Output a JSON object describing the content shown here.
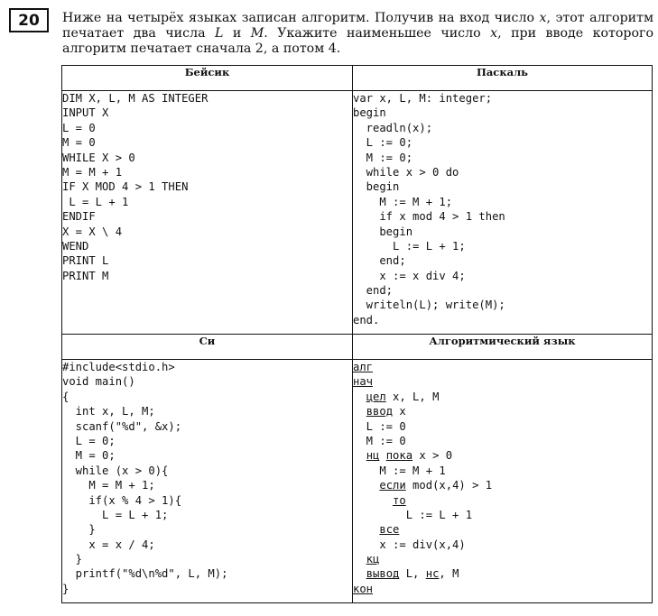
{
  "task": {
    "number": "20",
    "statement_parts": [
      "Ниже на четырёх языках записан алгоритм. Получив на вход число ",
      "x",
      ", этот алгоритм печатает два числа ",
      "L",
      " и ",
      "M",
      ". Укажите наименьшее число ",
      "x",
      ", при вводе которого алгоритм печатает сначала 2, а потом 4."
    ]
  },
  "headers": {
    "basic": "Бейсик",
    "pascal": "Паскаль",
    "c": "Си",
    "algo": "Алгоритмический язык"
  },
  "basic_code": [
    "DIM X, L, M AS INTEGER",
    "INPUT X",
    "L = 0",
    "M = 0",
    "WHILE X > 0",
    "M = M + 1",
    "IF X MOD 4 > 1 THEN",
    " L = L + 1",
    "ENDIF",
    "X = X \\ 4",
    "WEND",
    "PRINT L",
    "PRINT M"
  ],
  "pascal_code": [
    "var x, L, M: integer;",
    "begin",
    "  readln(x);",
    "  L := 0;",
    "  M := 0;",
    "  while x > 0 do",
    "  begin",
    "    M := M + 1;",
    "    if x mod 4 > 1 then",
    "    begin",
    "      L := L + 1;",
    "    end;",
    "    x := x div 4;",
    "  end;",
    "  writeln(L); write(M);",
    "end."
  ],
  "c_code": [
    "#include<stdio.h>",
    "void main()",
    "{",
    "  int x, L, M;",
    "  scanf(\"%d\", &x);",
    "  L = 0;",
    "  M = 0;",
    "  while (x > 0){",
    "    M = M + 1;",
    "    if(x % 4 > 1){",
    "      L = L + 1;",
    "    }",
    "    x = x / 4;",
    "  }",
    "  printf(\"%d\\n%d\", L, M);",
    "}"
  ],
  "algo_code": [
    [
      {
        "t": "алг",
        "u": true
      }
    ],
    [
      {
        "t": "нач",
        "u": true
      }
    ],
    [
      {
        "t": "  "
      },
      {
        "t": "цел",
        "u": true
      },
      {
        "t": " x, L, M"
      }
    ],
    [
      {
        "t": "  "
      },
      {
        "t": "ввод",
        "u": true
      },
      {
        "t": " x"
      }
    ],
    [
      {
        "t": "  L := 0"
      }
    ],
    [
      {
        "t": "  M := 0"
      }
    ],
    [
      {
        "t": "  "
      },
      {
        "t": "нц",
        "u": true
      },
      {
        "t": " "
      },
      {
        "t": "пока",
        "u": true
      },
      {
        "t": " x > 0"
      }
    ],
    [
      {
        "t": "    M := M + 1"
      }
    ],
    [
      {
        "t": "    "
      },
      {
        "t": "если",
        "u": true
      },
      {
        "t": " mod(x,4) > 1"
      }
    ],
    [
      {
        "t": "      "
      },
      {
        "t": "то",
        "u": true
      }
    ],
    [
      {
        "t": "        L := L + 1"
      }
    ],
    [
      {
        "t": "    "
      },
      {
        "t": "все",
        "u": true
      }
    ],
    [
      {
        "t": "    x := div(x,4)"
      }
    ],
    [
      {
        "t": "  "
      },
      {
        "t": "кц",
        "u": true
      }
    ],
    [
      {
        "t": "  "
      },
      {
        "t": "вывод",
        "u": true
      },
      {
        "t": " L, "
      },
      {
        "t": "нс",
        "u": true
      },
      {
        "t": ", M"
      }
    ],
    [
      {
        "t": "кон",
        "u": true
      }
    ]
  ]
}
